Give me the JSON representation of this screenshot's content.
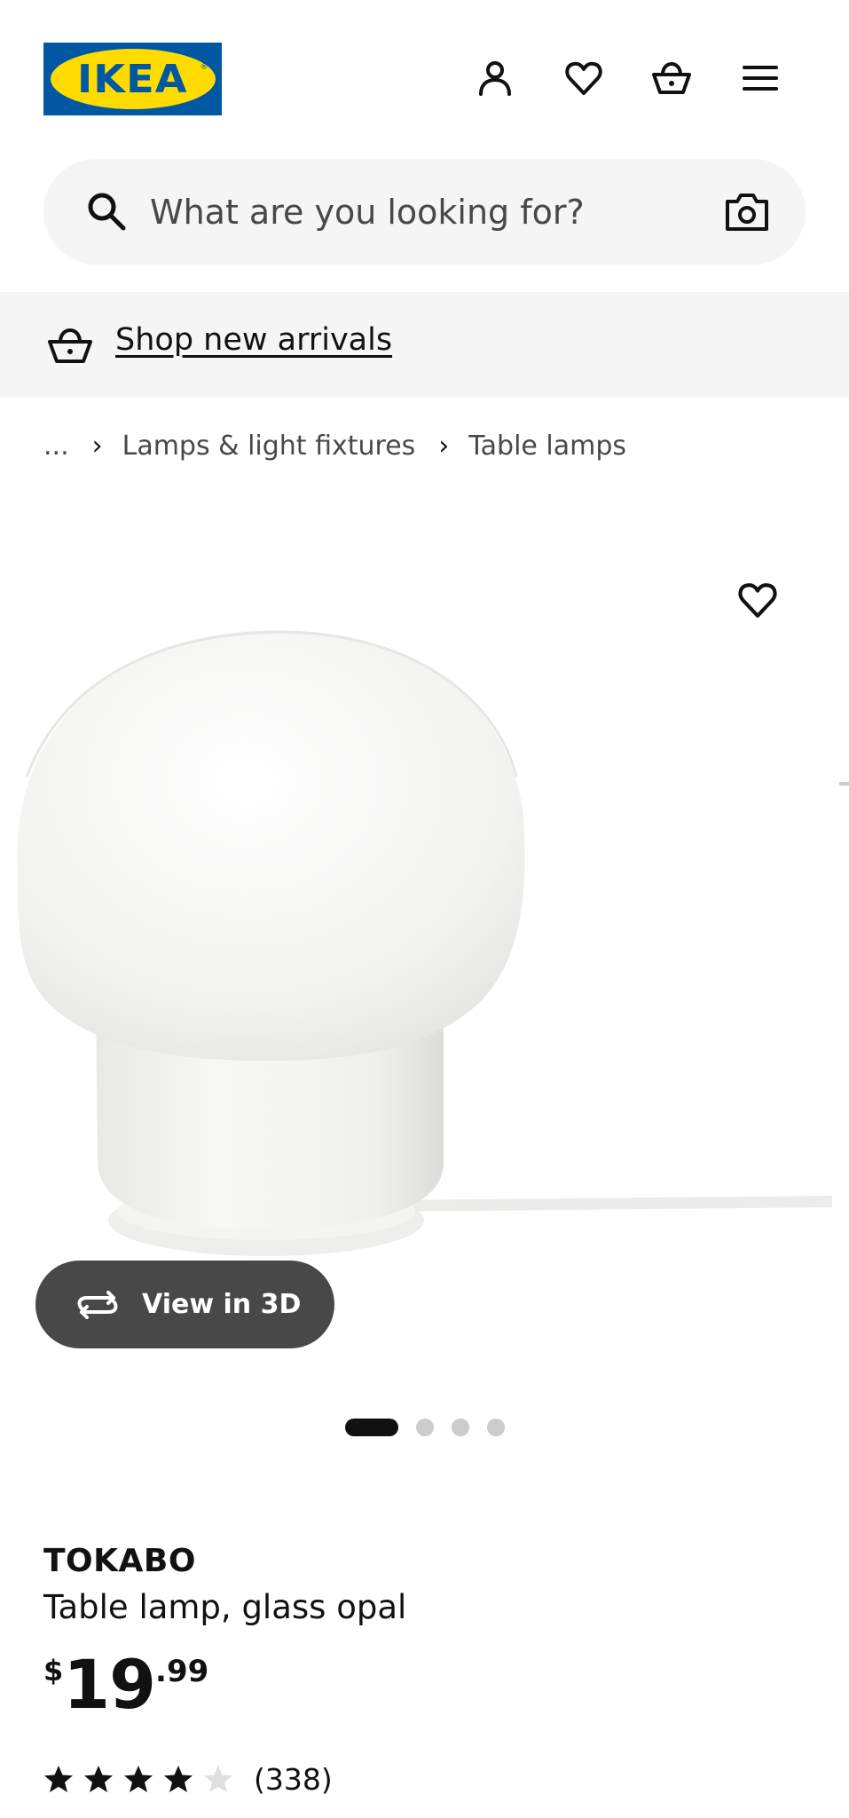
{
  "header": {
    "logo_text": "IKEA",
    "icons": [
      "user-icon",
      "heart-icon",
      "shopping-bag-icon",
      "hamburger-menu-icon"
    ]
  },
  "search": {
    "placeholder": "What are you looking for?",
    "icons": [
      "search-icon",
      "camera-icon"
    ]
  },
  "banner": {
    "link_label": "Shop new arrivals",
    "icon": "shopping-bag-icon"
  },
  "breadcrumb": {
    "items": [
      "...",
      "Lamps & light fixtures",
      "Table lamps"
    ]
  },
  "gallery": {
    "view3d_label": "View in 3D",
    "slide_count": 4,
    "active_slide": 1
  },
  "product": {
    "name": "TOKABO",
    "description": "Table lamp, glass opal",
    "price": {
      "currency": "$",
      "integer": "19",
      "decimal": ".99"
    },
    "rating": {
      "stars": 4,
      "max": 5,
      "count": "(338)"
    }
  },
  "colors": {
    "ikea_blue": "#0058a3",
    "ikea_yellow": "#ffdb00",
    "surface_grey": "#f5f5f5",
    "button_dark": "#484848",
    "text": "#111111"
  }
}
